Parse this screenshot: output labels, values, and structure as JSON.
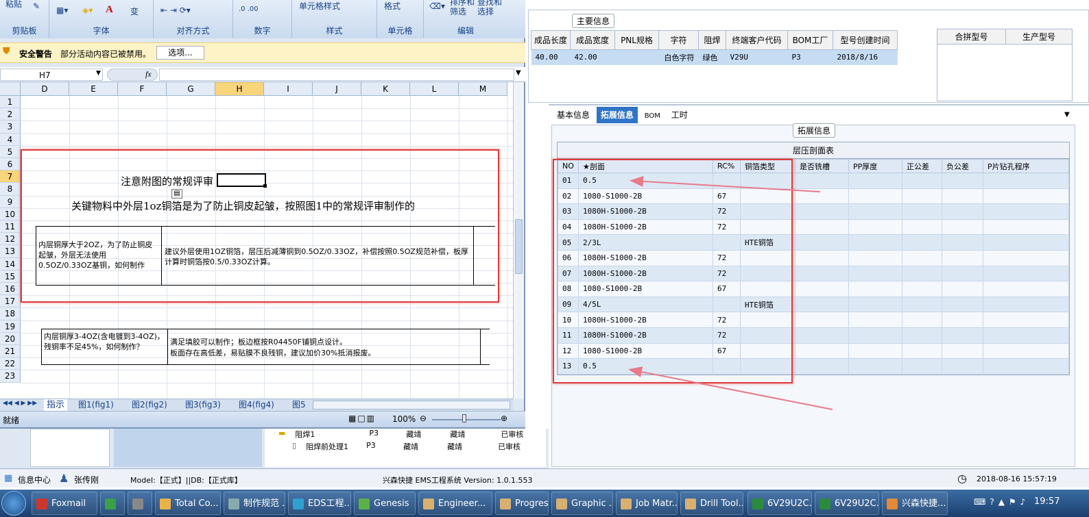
{
  "ribbon": {
    "paste": "粘贴",
    "groups": [
      "剪贴板",
      "字体",
      "对齐方式",
      "数字",
      "样式",
      "单元格",
      "编辑"
    ],
    "cell_style": "单元格样式",
    "format": "格式",
    "sort_filter": "排序和 筛选",
    "find_select": "查找和 选择",
    "font_color_letter": "A",
    "wrap_label": "变"
  },
  "security": {
    "title": "安全警告",
    "message": "部分活动内容已被禁用。",
    "options_button": "选项..."
  },
  "formula_bar": {
    "name_box": "H7",
    "fx": "fx"
  },
  "grid": {
    "columns": [
      "D",
      "E",
      "F",
      "G",
      "H",
      "I",
      "J",
      "K",
      "L",
      "M"
    ],
    "selected_column": "H",
    "rows": [
      "1",
      "2",
      "3",
      "4",
      "5",
      "6",
      "7",
      "8",
      "9",
      "10",
      "11",
      "12",
      "13",
      "14",
      "15",
      "16",
      "17",
      "18",
      "19",
      "20",
      "21",
      "22",
      "23"
    ],
    "selected_row": "7",
    "note_title": "注意附图的常规评审",
    "note_line": "关键物料中外层1oz铜箔是为了防止铜皮起皱，按照图1中的常规评审制作的",
    "t1_left": "内层铜厚大于2OZ，为了防止铜皮起皱，外层无法使用0.5OZ/0.33OZ基铜，如何制作",
    "t1_right": "建议外层使用1OZ铜箔，层压后减薄铜到0.5OZ/0.33OZ，补偿按照0.5OZ规范补偿，板厚计算时铜箔按0.5/0.33OZ计算。",
    "t2_left": "内层铜厚3-4OZ(含电镀到3-4OZ)，残铜率不足45%，如何制作？",
    "t2_right_1": "满足填胶可以制作；板边框按R04450F铺铜点设计。",
    "t2_right_2": "板面存在高低差，易贴膜不良残铜，建议加价30%抵消报废。"
  },
  "sheet_tabs": [
    "指示",
    "图1(fig1)",
    "图2(fig2)",
    "图3(fig3)",
    "图4(fig4)",
    "图5"
  ],
  "excel_status": {
    "ready": "就绪",
    "zoom": "100%"
  },
  "tree_rows": [
    {
      "name": "阻焊1",
      "c1": "P3",
      "c2": "藏靖",
      "c3": "藏靖",
      "c4": "已审核"
    },
    {
      "name": "阻焊前处理1",
      "c1": "P3",
      "c2": "藏靖",
      "c3": "藏靖",
      "c4": "已审核"
    }
  ],
  "main_info": {
    "title": "主要信息",
    "headers": [
      "成品长度",
      "成品宽度",
      "PNL规格",
      "字符",
      "阻焊",
      "终端客户代码",
      "BOM工厂",
      "型号创建时间"
    ],
    "values": [
      "40.00",
      "42.00",
      "",
      "白色字符",
      "绿色",
      "V29U",
      "P3",
      "2018/8/16"
    ],
    "extra_headers": [
      "合拼型号",
      "生产型号"
    ]
  },
  "ext_tabs": [
    "基本信息",
    "拓展信息",
    "BOM",
    "工时"
  ],
  "ext_title": "拓展信息",
  "layup": {
    "caption": "层压剖面表",
    "headers": [
      "NO",
      "★剖面",
      "RC%",
      "铜箔类型",
      "是否铣槽",
      "PP厚度",
      "正公差",
      "负公差",
      "P片钻孔程序"
    ],
    "rows": [
      [
        "01",
        "0.5",
        "",
        ""
      ],
      [
        "02",
        "1080-S1000-2B",
        "67",
        ""
      ],
      [
        "03",
        "1080H-S1000-2B",
        "72",
        ""
      ],
      [
        "04",
        "1080H-S1000-2B",
        "72",
        ""
      ],
      [
        "05",
        "2/3L",
        "",
        "HTE铜箔"
      ],
      [
        "06",
        "1080H-S1000-2B",
        "72",
        ""
      ],
      [
        "07",
        "1080H-S1000-2B",
        "72",
        ""
      ],
      [
        "08",
        "1080-S1000-2B",
        "67",
        ""
      ],
      [
        "09",
        "4/5L",
        "",
        "HTE铜箔"
      ],
      [
        "10",
        "1080H-S1000-2B",
        "72",
        ""
      ],
      [
        "11",
        "1080H-S1000-2B",
        "72",
        ""
      ],
      [
        "12",
        "1080-S1000-2B",
        "67",
        ""
      ],
      [
        "13",
        "0.5",
        "",
        ""
      ]
    ]
  },
  "bottom_info": {
    "info_center": "信息中心",
    "user": "张传刚",
    "model_db": "Model:【正式】||DB:【正式库】",
    "system": "兴森快捷 EMS工程系统 Version: 1.0.1.553",
    "datetime": "2018-08-16 15:57:19"
  },
  "taskbar": {
    "items": [
      "Foxmail",
      "",
      "",
      "Total Co...",
      "制作规范 ...",
      "EDS工程...",
      "Genesis",
      "Engineer...",
      "Progress",
      "Graphic ...",
      "Job Matr...",
      "Drill Tool...",
      "6V29U2C...",
      "6V29U2C...",
      "兴森快捷..."
    ],
    "clock": "19:57"
  },
  "colors": {
    "accent": "#2f74c7",
    "highlight": "#e03a3a",
    "selected_row": "#c6dcf3"
  }
}
